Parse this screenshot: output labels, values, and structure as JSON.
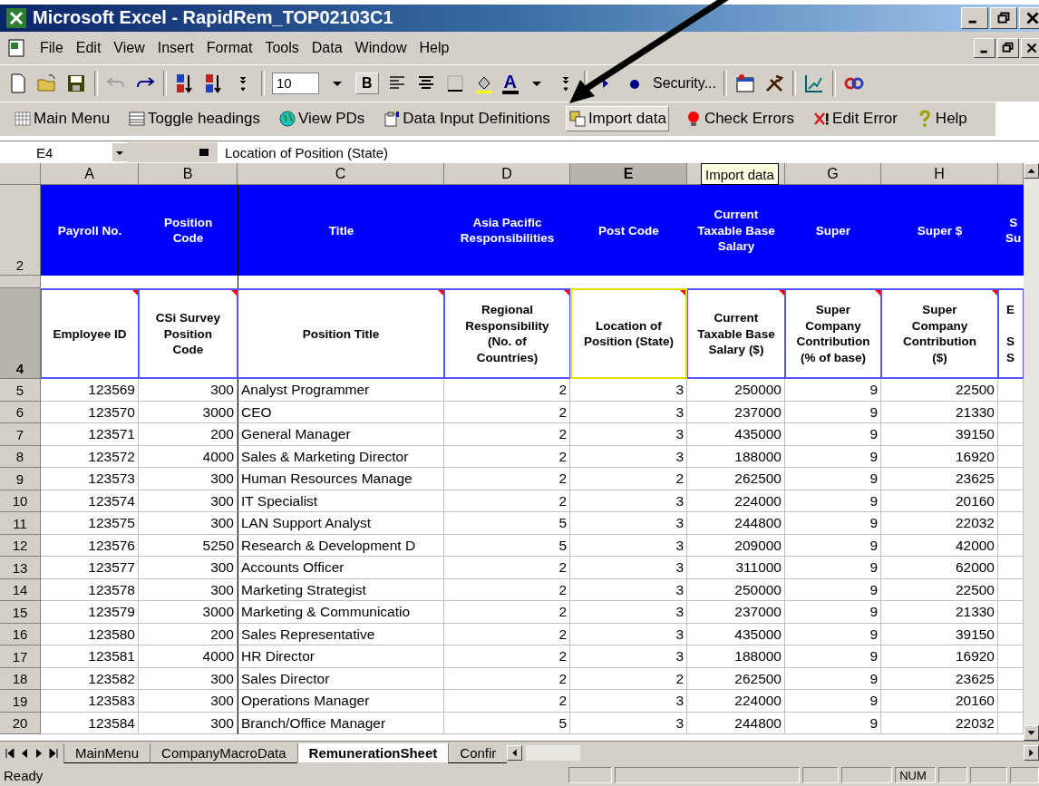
{
  "window": {
    "title": "Microsoft Excel - RapidRem_TOP02103C1"
  },
  "menu_bar": {
    "items": [
      {
        "label": "File"
      },
      {
        "label": "Edit"
      },
      {
        "label": "View"
      },
      {
        "label": "Insert"
      },
      {
        "label": "Format"
      },
      {
        "label": "Tools"
      },
      {
        "label": "Data"
      },
      {
        "label": "Window"
      },
      {
        "label": "Help"
      }
    ]
  },
  "toolbar": {
    "font_size": "10",
    "bold": "B",
    "font_color": "A",
    "security": "Security..."
  },
  "custom_toolbar": {
    "items": [
      {
        "label": "Main Menu",
        "pressed": false
      },
      {
        "label": "Toggle headings",
        "pressed": false
      },
      {
        "label": "View PDs",
        "pressed": false
      },
      {
        "label": "Data Input Definitions",
        "pressed": false
      },
      {
        "label": "Import data",
        "pressed": true
      },
      {
        "label": "Check Errors",
        "pressed": false
      },
      {
        "label": "Edit Error",
        "pressed": false
      },
      {
        "label": "Help",
        "pressed": false
      }
    ]
  },
  "formula_bar": {
    "name_box": "E4",
    "content": "Location of Position (State)"
  },
  "tooltip": {
    "text": "Import data"
  },
  "columns": [
    {
      "letter": "A",
      "selected": false
    },
    {
      "letter": "B",
      "selected": false
    },
    {
      "letter": "C",
      "selected": false
    },
    {
      "letter": "D",
      "selected": false
    },
    {
      "letter": "E",
      "selected": true
    },
    {
      "selected": false
    },
    {
      "letter": "G",
      "selected": false
    },
    {
      "letter": "H",
      "selected": false
    },
    {
      "selected": false
    }
  ],
  "header_rows": [
    {
      "number": "2",
      "selected": false,
      "kind": "banner",
      "cells": [
        {
          "text": "Payroll No."
        },
        {
          "text": "Position\nCode"
        },
        {
          "text": "Title"
        },
        {
          "text": "Asia Pacific\nResponsibilities"
        },
        {
          "text": "Post Code"
        },
        {
          "text": "Current\nTaxable Base\nSalary"
        },
        {
          "text": "Super"
        },
        {
          "text": "Super $"
        },
        {
          "text": "S\nSu"
        }
      ]
    },
    {
      "selected": false,
      "kind": "spacer",
      "cells": []
    },
    {
      "number": "4",
      "selected": true,
      "kind": "labels",
      "cells": [
        {
          "text": "Employee ID",
          "comment": true
        },
        {
          "text": "CSi Survey\nPosition\nCode",
          "comment": true
        },
        {
          "text": "Position Title",
          "comment": true
        },
        {
          "text": "Regional\nResponsibility\n(No. of\nCountries)",
          "comment": true
        },
        {
          "text": "Location of\nPosition (State)",
          "comment": true
        },
        {
          "text": "Current\nTaxable Base\nSalary   ($)",
          "comment": true
        },
        {
          "text": "Super\nCompany\nContribution\n(% of base)",
          "comment": true
        },
        {
          "text": "Super\nCompany\nContribution\n($)",
          "comment": true
        },
        {
          "text": "E\n\nS\nS",
          "comment": false
        }
      ]
    }
  ],
  "rows": [
    {
      "number": "5",
      "cells": [
        "123569",
        "300",
        "Analyst Programmer",
        "2",
        "3",
        "250000",
        "9",
        "22500"
      ]
    },
    {
      "number": "6",
      "cells": [
        "123570",
        "3000",
        "CEO",
        "2",
        "3",
        "237000",
        "9",
        "21330"
      ]
    },
    {
      "number": "7",
      "cells": [
        "123571",
        "200",
        "General Manager",
        "2",
        "3",
        "435000",
        "9",
        "39150"
      ]
    },
    {
      "number": "8",
      "cells": [
        "123572",
        "4000",
        "Sales & Marketing Director",
        "2",
        "3",
        "188000",
        "9",
        "16920"
      ]
    },
    {
      "number": "9",
      "cells": [
        "123573",
        "300",
        "Human Resources Manage",
        "2",
        "2",
        "262500",
        "9",
        "23625"
      ]
    },
    {
      "number": "10",
      "cells": [
        "123574",
        "300",
        "IT Specialist",
        "2",
        "3",
        "224000",
        "9",
        "20160"
      ]
    },
    {
      "number": "11",
      "cells": [
        "123575",
        "300",
        "LAN Support Analyst",
        "5",
        "3",
        "244800",
        "9",
        "22032"
      ]
    },
    {
      "number": "12",
      "cells": [
        "123576",
        "5250",
        "Research & Development D",
        "5",
        "3",
        "209000",
        "9",
        "42000"
      ]
    },
    {
      "number": "13",
      "cells": [
        "123577",
        "300",
        "Accounts Officer",
        "2",
        "3",
        "311000",
        "9",
        "62000"
      ]
    },
    {
      "number": "14",
      "cells": [
        "123578",
        "300",
        "Marketing Strategist",
        "2",
        "3",
        "250000",
        "9",
        "22500"
      ]
    },
    {
      "number": "15",
      "cells": [
        "123579",
        "3000",
        "Marketing & Communicatio",
        "2",
        "3",
        "237000",
        "9",
        "21330"
      ]
    },
    {
      "number": "16",
      "cells": [
        "123580",
        "200",
        "Sales Representative",
        "2",
        "3",
        "435000",
        "9",
        "39150"
      ]
    },
    {
      "number": "17",
      "cells": [
        "123581",
        "4000",
        "HR Director",
        "2",
        "3",
        "188000",
        "9",
        "16920"
      ]
    },
    {
      "number": "18",
      "cells": [
        "123582",
        "300",
        "Sales Director",
        "2",
        "2",
        "262500",
        "9",
        "23625"
      ]
    },
    {
      "number": "19",
      "cells": [
        "123583",
        "300",
        "Operations Manager",
        "2",
        "3",
        "224000",
        "9",
        "20160"
      ]
    },
    {
      "number": "20",
      "cells": [
        "123584",
        "300",
        "Branch/Office Manager",
        "5",
        "3",
        "244800",
        "9",
        "22032"
      ]
    }
  ],
  "sheet_tabs": [
    {
      "label": "MainMenu",
      "selected": false
    },
    {
      "label": "CompanyMacroData",
      "selected": false
    },
    {
      "label": "RemunerationSheet",
      "selected": true
    },
    {
      "label": "Confir",
      "selected": false
    }
  ],
  "status_bar": {
    "text": "Ready",
    "num": "NUM"
  }
}
